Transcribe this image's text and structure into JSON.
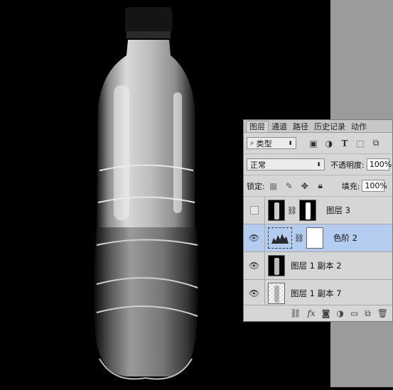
{
  "tabs": [
    "图层",
    "通道",
    "路径",
    "历史记录",
    "动作"
  ],
  "filter": {
    "label": "类型"
  },
  "blend_mode": "正常",
  "opacity": {
    "label": "不透明度:",
    "value": "100%"
  },
  "lock_label": "锁定:",
  "fill": {
    "label": "填充:",
    "value": "100%"
  },
  "layers": [
    {
      "name": "图层 3",
      "visible": false
    },
    {
      "name": "色阶 2",
      "visible": true
    },
    {
      "name": "图层 1 副本 2",
      "visible": true
    },
    {
      "name": "图层 1 副本 7",
      "visible": true
    }
  ]
}
